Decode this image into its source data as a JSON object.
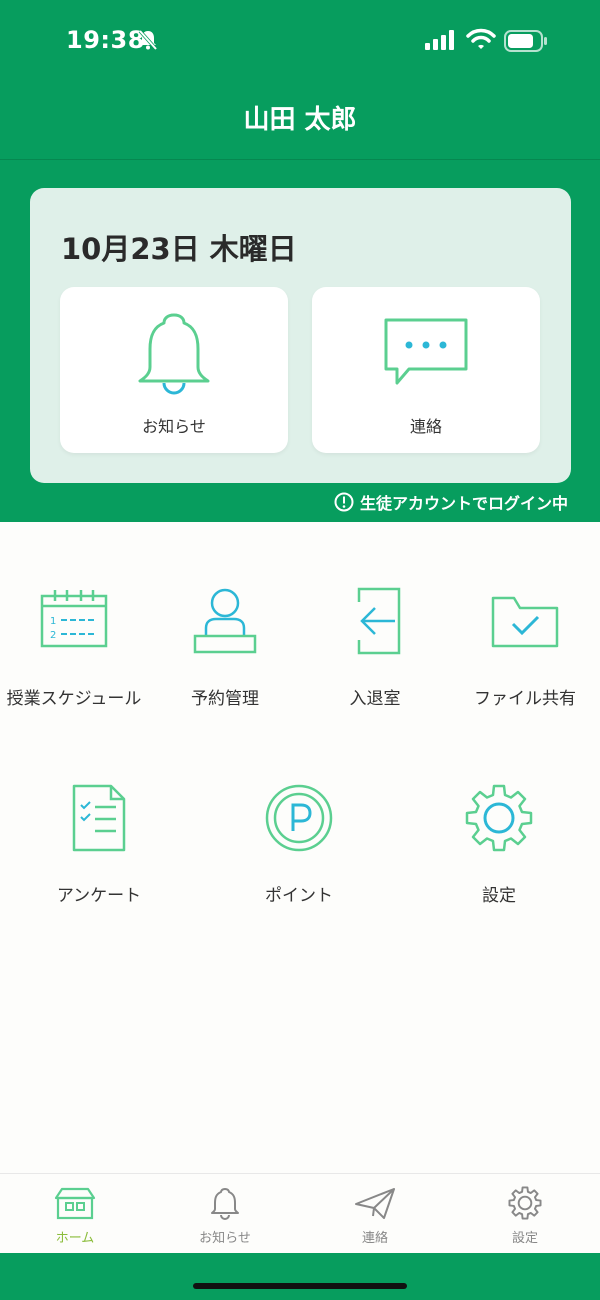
{
  "status_bar": {
    "time": "19:38",
    "icons": [
      "bell-slash-icon",
      "cellular-signal-icon",
      "wifi-icon",
      "battery-icon"
    ]
  },
  "header": {
    "title": "山田 太郎"
  },
  "card": {
    "date": "10月23日 木曜日",
    "tiles": [
      {
        "label": "お知らせ",
        "icon": "bell-icon"
      },
      {
        "label": "連絡",
        "icon": "chat-bubble-icon"
      }
    ]
  },
  "login_note": {
    "text": "生徒アカウントでログイン中",
    "icon": "exclamation-circle-icon"
  },
  "menu": {
    "row1": [
      {
        "label": "授業スケジュール",
        "icon": "calendar-icon"
      },
      {
        "label": "予約管理",
        "icon": "person-desk-icon"
      },
      {
        "label": "入退室",
        "icon": "door-arrow-icon"
      },
      {
        "label": "ファイル共有",
        "icon": "folder-check-icon"
      }
    ],
    "row2": [
      {
        "label": "アンケート",
        "icon": "checklist-document-icon"
      },
      {
        "label": "ポイント",
        "icon": "point-coin-icon"
      },
      {
        "label": "設定",
        "icon": "gear-icon"
      }
    ]
  },
  "tabbar": {
    "items": [
      {
        "label": "ホーム",
        "icon": "house-icon",
        "active": true
      },
      {
        "label": "お知らせ",
        "icon": "bell-icon",
        "active": false
      },
      {
        "label": "連絡",
        "icon": "paper-plane-icon",
        "active": false
      },
      {
        "label": "設定",
        "icon": "gear-icon",
        "active": false
      }
    ]
  },
  "colors": {
    "brand_green": "#079d5e",
    "icon_green": "#5bcf90",
    "icon_blue": "#2cb7d6",
    "card_bg": "#dff0e9",
    "tab_active": "#8bbd3b"
  }
}
